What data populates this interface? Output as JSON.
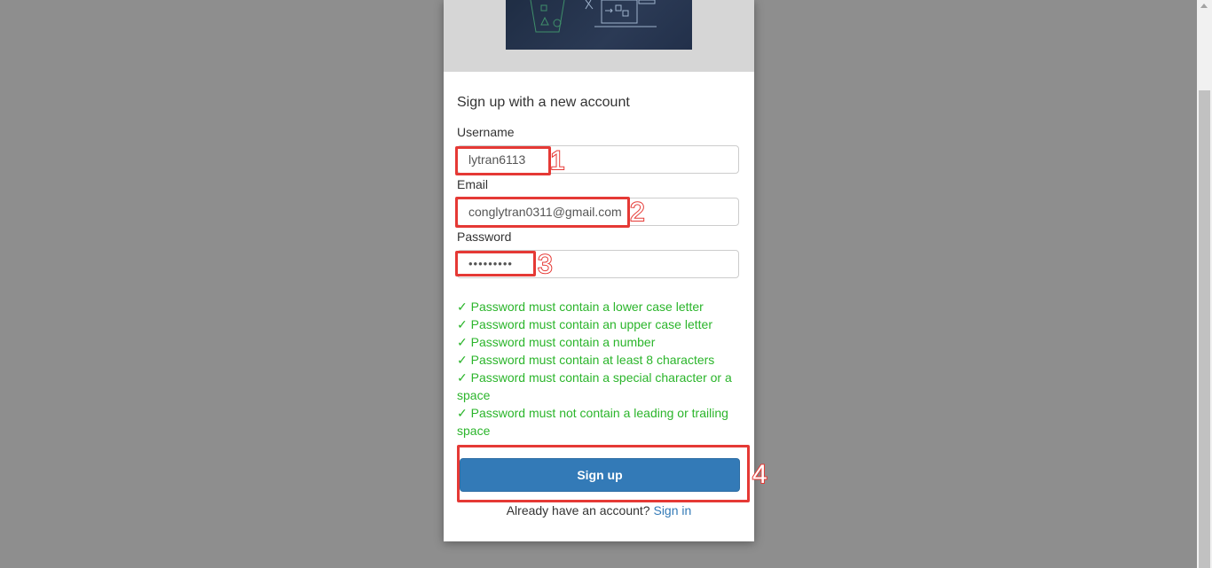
{
  "form": {
    "title": "Sign up with a new account",
    "username_label": "Username",
    "username_value": "lytran6113",
    "email_label": "Email",
    "email_value": "conglytran0311@gmail.com",
    "password_label": "Password",
    "password_value": "•••••••••",
    "rules": [
      "✓ Password must contain a lower case letter",
      "✓ Password must contain an upper case letter",
      "✓ Password must contain a number",
      "✓ Password must contain at least 8 characters",
      "✓ Password must contain a special character or a space",
      "✓ Password must not contain a leading or trailing space"
    ],
    "signup_label": "Sign up",
    "already_text": "Already have an account?",
    "signin_label": "Sign in"
  },
  "annotations": [
    "1",
    "2",
    "3",
    "4"
  ],
  "colors": {
    "background": "#8e8e8e",
    "primary_button": "#337ab7",
    "rule_ok": "#2bb52b",
    "annotation": "#e53935"
  }
}
